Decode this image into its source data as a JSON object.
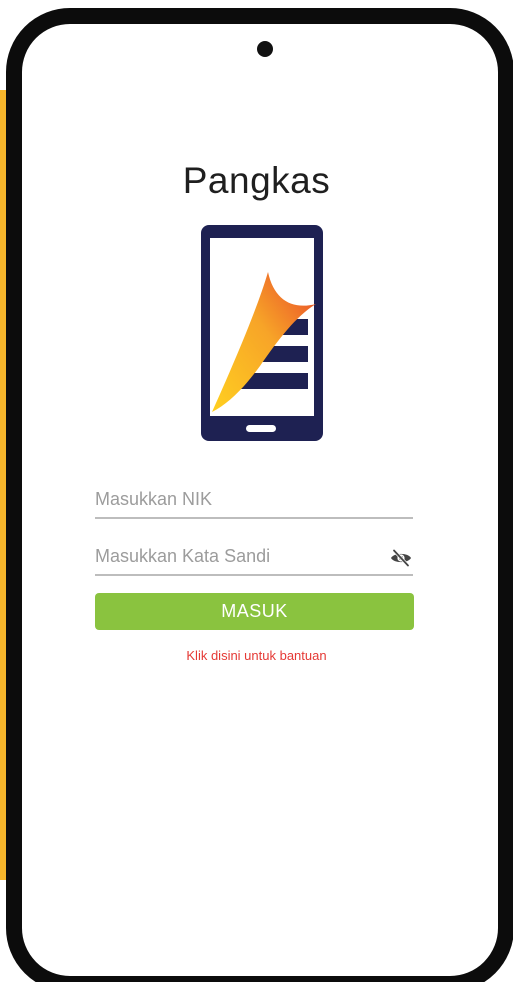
{
  "app": {
    "title": "Pangkas",
    "logo_icon": "pangkas-phone-logo-icon",
    "colors": {
      "frame": "#0c0c0c",
      "accent_side": "#f6b52b",
      "logo_navy": "#1e2152",
      "button": "#8ac33f",
      "link": "#e53935"
    }
  },
  "form": {
    "nik": {
      "value": "",
      "placeholder": "Masukkan NIK"
    },
    "password": {
      "value": "",
      "placeholder": "Masukkan Kata Sandi",
      "toggle_icon": "eye-slash-icon"
    },
    "submit_label": "MASUK",
    "help_link": "Klik disini untuk bantuan"
  }
}
